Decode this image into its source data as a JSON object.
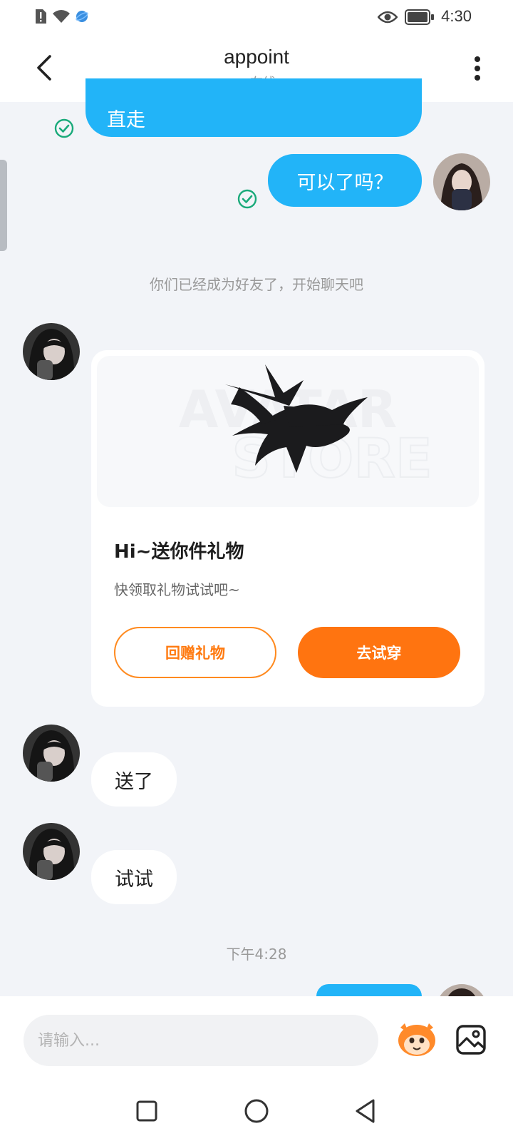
{
  "status_bar": {
    "time": "4:30"
  },
  "header": {
    "title": "appoint",
    "status": "在线"
  },
  "messages": {
    "sent_partial": "直走",
    "sent_question": "可以了吗？",
    "system_notice": "你们已经成为好友了，开始聊天吧",
    "received_sent": "送了",
    "received_try": "试试",
    "timestamp": "下午4:28"
  },
  "gift_card": {
    "watermark_top": "AVATAR",
    "watermark_bottom": "STORE",
    "title": "Hi~送你件礼物",
    "subtitle": "快领取礼物试试吧~",
    "return_gift_label": "回赠礼物",
    "try_on_label": "去试穿"
  },
  "input": {
    "placeholder": "请输入..."
  },
  "colors": {
    "sent_bubble": "#22b4f8",
    "accent_orange": "#ff7410",
    "online_dot": "#21c24a",
    "read_check": "#1aaa7a"
  }
}
